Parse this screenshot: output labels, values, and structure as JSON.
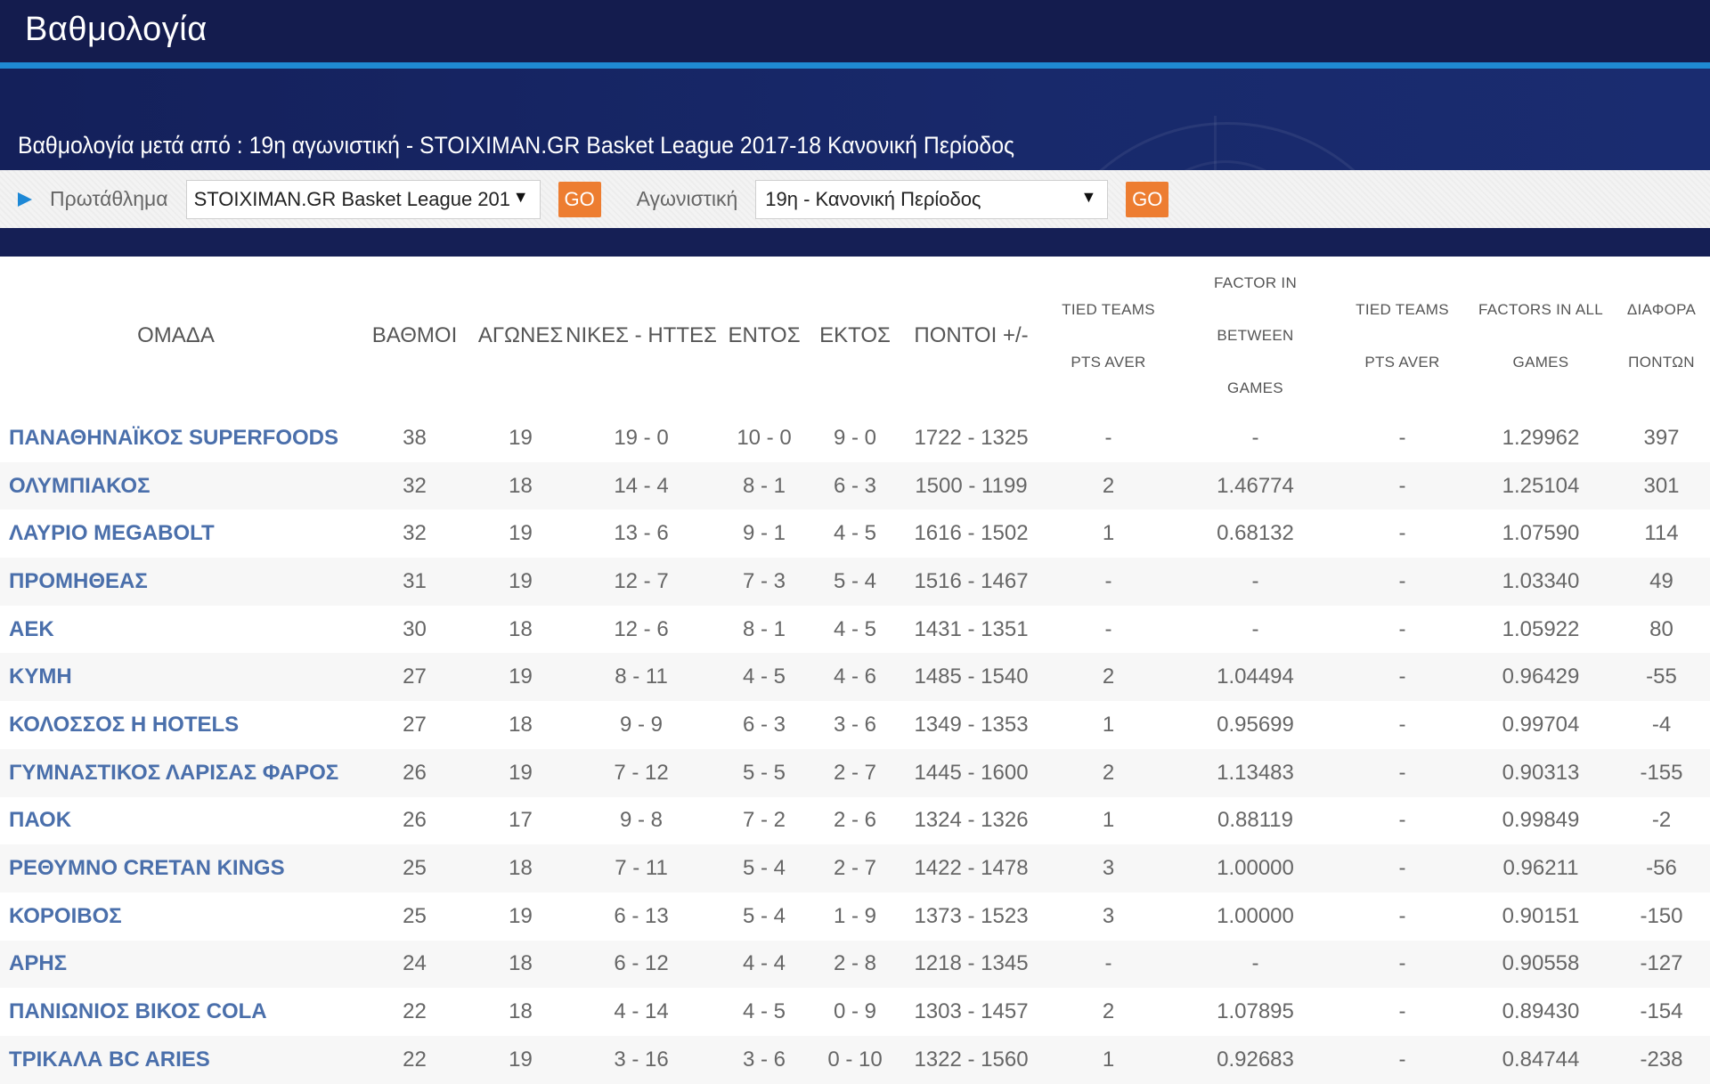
{
  "header": {
    "title": "Βαθμολογία",
    "subtitle": "Βαθμολογία μετά από : 19η αγωνιστική - STOIXIMAN.GR Basket League 2017-18 Κανονική Περίοδος"
  },
  "filters": {
    "championship_label": "Πρωτάθλημα",
    "championship_value": "STOIXIMAN.GR Basket League 201",
    "round_label": "Αγωνιστική",
    "round_value": "19η - Κανονική Περίοδος",
    "go_label": "GO"
  },
  "colors": {
    "accent": "#1d88d6",
    "go": "#ed7d31",
    "navy": "#141c4e",
    "team": "#4a6fab"
  },
  "table": {
    "headers": {
      "team": "ΟΜΑΔΑ",
      "points": "ΒΑΘΜΟΙ",
      "games": "ΑΓΩΝΕΣ",
      "wl": "ΝΙΚΕΣ - ΗΤΤΕΣ",
      "home": "ΕΝΤΟΣ",
      "away": "ΕΚΤΟΣ",
      "score": "ΠΟΝΤΟΙ +/-",
      "tied1_a": "TIED TEAMS",
      "tied1_b": "PTS AVER",
      "factor1_a": "FACTOR IN BETWEEN",
      "factor1_b": "GAMES",
      "tied2_a": "TIED TEAMS",
      "tied2_b": "PTS AVER",
      "factor2_a": "FACTORS IN ALL",
      "factor2_b": "GAMES",
      "diff_a": "ΔΙΑΦΟΡΑ",
      "diff_b": "ΠΟΝΤΩΝ"
    },
    "rows": [
      {
        "team": "ΠΑΝΑΘΗΝΑΪΚΟΣ SUPERFOODS",
        "pts": "38",
        "games": "19",
        "wl": "19 - 0",
        "home": "10 - 0",
        "away": "9 - 0",
        "score": "1722 - 1325",
        "tied1": "-",
        "factor1": "-",
        "tied2": "-",
        "factor2": "1.29962",
        "diff": "397"
      },
      {
        "team": "ΟΛΥΜΠΙΑΚΟΣ",
        "pts": "32",
        "games": "18",
        "wl": "14 - 4",
        "home": "8 - 1",
        "away": "6 - 3",
        "score": "1500 - 1199",
        "tied1": "2",
        "factor1": "1.46774",
        "tied2": "-",
        "factor2": "1.25104",
        "diff": "301"
      },
      {
        "team": "ΛΑΥΡΙΟ MEGABOLT",
        "pts": "32",
        "games": "19",
        "wl": "13 - 6",
        "home": "9 - 1",
        "away": "4 - 5",
        "score": "1616 - 1502",
        "tied1": "1",
        "factor1": "0.68132",
        "tied2": "-",
        "factor2": "1.07590",
        "diff": "114"
      },
      {
        "team": "ΠΡΟΜΗΘΕΑΣ",
        "pts": "31",
        "games": "19",
        "wl": "12 - 7",
        "home": "7 - 3",
        "away": "5 - 4",
        "score": "1516 - 1467",
        "tied1": "-",
        "factor1": "-",
        "tied2": "-",
        "factor2": "1.03340",
        "diff": "49"
      },
      {
        "team": "ΑΕΚ",
        "pts": "30",
        "games": "18",
        "wl": "12 - 6",
        "home": "8 - 1",
        "away": "4 - 5",
        "score": "1431 - 1351",
        "tied1": "-",
        "factor1": "-",
        "tied2": "-",
        "factor2": "1.05922",
        "diff": "80"
      },
      {
        "team": "ΚΥΜΗ",
        "pts": "27",
        "games": "19",
        "wl": "8 - 11",
        "home": "4 - 5",
        "away": "4 - 6",
        "score": "1485 - 1540",
        "tied1": "2",
        "factor1": "1.04494",
        "tied2": "-",
        "factor2": "0.96429",
        "diff": "-55"
      },
      {
        "team": "ΚΟΛΟΣΣΟΣ H HOTELS",
        "pts": "27",
        "games": "18",
        "wl": "9 - 9",
        "home": "6 - 3",
        "away": "3 - 6",
        "score": "1349 - 1353",
        "tied1": "1",
        "factor1": "0.95699",
        "tied2": "-",
        "factor2": "0.99704",
        "diff": "-4"
      },
      {
        "team": "ΓΥΜΝΑΣΤΙΚΟΣ ΛΑΡΙΣΑΣ ΦΑΡΟΣ",
        "pts": "26",
        "games": "19",
        "wl": "7 - 12",
        "home": "5 - 5",
        "away": "2 - 7",
        "score": "1445 - 1600",
        "tied1": "2",
        "factor1": "1.13483",
        "tied2": "-",
        "factor2": "0.90313",
        "diff": "-155"
      },
      {
        "team": "ΠΑΟΚ",
        "pts": "26",
        "games": "17",
        "wl": "9 - 8",
        "home": "7 - 2",
        "away": "2 - 6",
        "score": "1324 - 1326",
        "tied1": "1",
        "factor1": "0.88119",
        "tied2": "-",
        "factor2": "0.99849",
        "diff": "-2"
      },
      {
        "team": "ΡΕΘΥΜΝΟ CRETAN KINGS",
        "pts": "25",
        "games": "18",
        "wl": "7 - 11",
        "home": "5 - 4",
        "away": "2 - 7",
        "score": "1422 - 1478",
        "tied1": "3",
        "factor1": "1.00000",
        "tied2": "-",
        "factor2": "0.96211",
        "diff": "-56"
      },
      {
        "team": "ΚΟΡΟΙΒΟΣ",
        "pts": "25",
        "games": "19",
        "wl": "6 - 13",
        "home": "5 - 4",
        "away": "1 - 9",
        "score": "1373 - 1523",
        "tied1": "3",
        "factor1": "1.00000",
        "tied2": "-",
        "factor2": "0.90151",
        "diff": "-150"
      },
      {
        "team": "ΑΡΗΣ",
        "pts": "24",
        "games": "18",
        "wl": "6 - 12",
        "home": "4 - 4",
        "away": "2 - 8",
        "score": "1218 - 1345",
        "tied1": "-",
        "factor1": "-",
        "tied2": "-",
        "factor2": "0.90558",
        "diff": "-127"
      },
      {
        "team": "ΠΑΝΙΩΝΙΟΣ ΒΙΚΟΣ COLA",
        "pts": "22",
        "games": "18",
        "wl": "4 - 14",
        "home": "4 - 5",
        "away": "0 - 9",
        "score": "1303 - 1457",
        "tied1": "2",
        "factor1": "1.07895",
        "tied2": "-",
        "factor2": "0.89430",
        "diff": "-154"
      },
      {
        "team": "ΤΡΙΚΑΛΑ BC ARIES",
        "pts": "22",
        "games": "19",
        "wl": "3 - 16",
        "home": "3 - 6",
        "away": "0 - 10",
        "score": "1322 - 1560",
        "tied1": "1",
        "factor1": "0.92683",
        "tied2": "-",
        "factor2": "0.84744",
        "diff": "-238"
      }
    ]
  }
}
